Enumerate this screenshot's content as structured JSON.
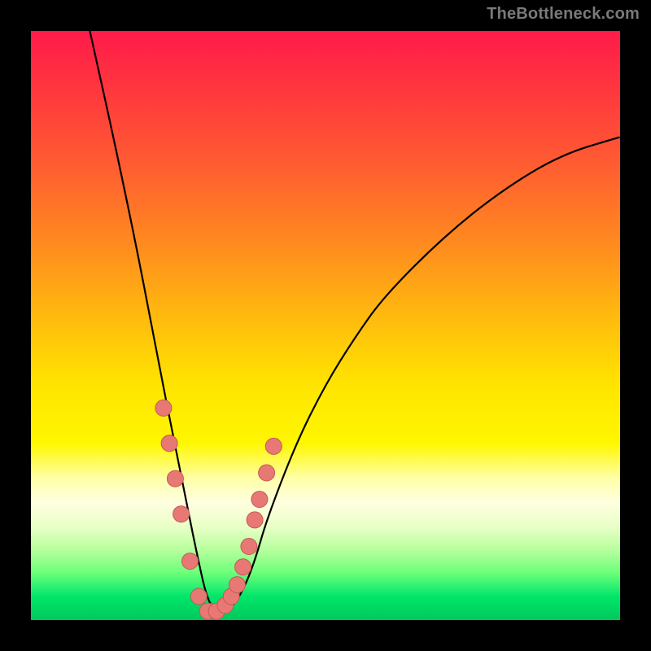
{
  "watermark": "TheBottleneck.com",
  "colors": {
    "background": "#000000",
    "curve_stroke": "#000000",
    "dot_fill": "#e77874",
    "dot_stroke": "#c25a56"
  },
  "chart_data": {
    "type": "line",
    "title": "",
    "xlabel": "",
    "ylabel": "",
    "xlim": [
      0,
      100
    ],
    "ylim": [
      0,
      100
    ],
    "grid": false,
    "legend": false,
    "note": "Axis values are approximate (no tick labels in source image). Curve is a V-shaped bottleneck profile with minimum near x≈30, y≈0.",
    "series": [
      {
        "name": "bottleneck-curve",
        "x": [
          10,
          14,
          18,
          22,
          24,
          26,
          28,
          30,
          32,
          34,
          36,
          38,
          40,
          45,
          50,
          55,
          60,
          70,
          80,
          90,
          100
        ],
        "y": [
          100,
          82,
          63,
          42,
          32,
          22,
          12,
          3,
          1,
          2,
          5,
          10,
          17,
          30,
          40,
          48,
          55,
          65,
          73,
          79,
          82
        ]
      }
    ],
    "highlighted_points": {
      "name": "dots",
      "x": [
        22.5,
        23.5,
        24.5,
        25.5,
        27.0,
        28.5,
        30.0,
        31.5,
        33.0,
        34.0,
        35.0,
        36.0,
        37.0,
        38.0,
        38.8,
        40.0,
        41.2
      ],
      "y": [
        36.0,
        30.0,
        24.0,
        18.0,
        10.0,
        4.0,
        1.5,
        1.5,
        2.5,
        4.0,
        6.0,
        9.0,
        12.5,
        17.0,
        20.5,
        25.0,
        29.5
      ]
    }
  }
}
